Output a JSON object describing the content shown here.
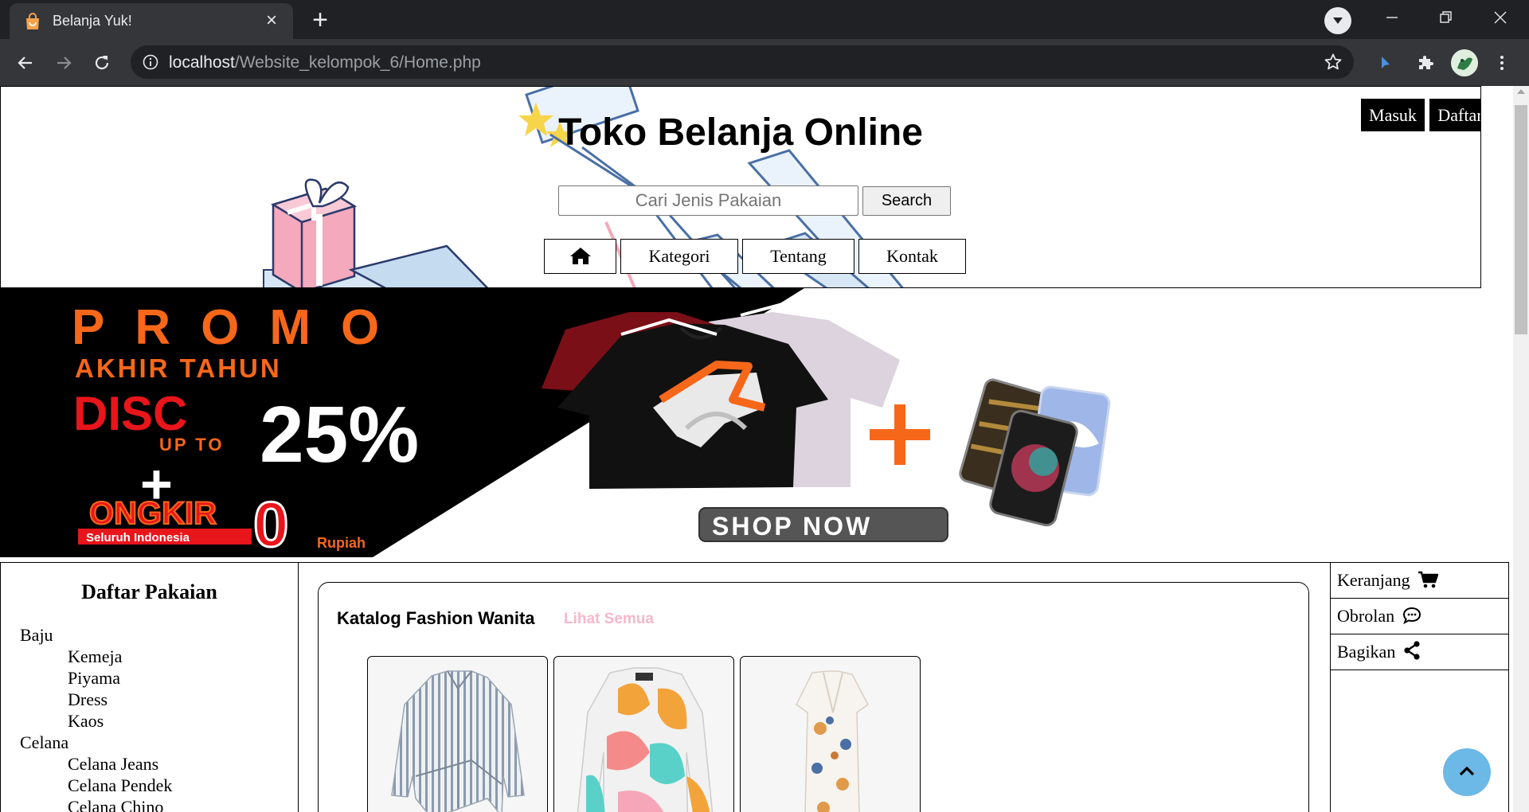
{
  "browser": {
    "tab_title": "Belanja Yuk!",
    "url_host": "localhost",
    "url_path": "/Website_kelompok_6/Home.php"
  },
  "header": {
    "title": "Toko Belanja Online",
    "search_placeholder": "Cari Jenis Pakaian",
    "search_button": "Search",
    "menu": {
      "kategori": "Kategori",
      "tentang": "Tentang",
      "kontak": "Kontak"
    },
    "login_button": "Masuk",
    "register_button": "Daftar"
  },
  "banner": {
    "promo": "PROMO",
    "promo_sub": "AKHIR TAHUN",
    "disc": "DISC",
    "up_to": "UP TO",
    "percent": "25%",
    "plus": "+",
    "ongkir": "ONGKIR",
    "ongkir_sub": "Seluruh Indonesia",
    "zero": "0",
    "rupiah": "Rupiah",
    "shop_now": "SHOP NOW"
  },
  "sidebar": {
    "title": "Daftar Pakaian",
    "baju": "Baju",
    "baju_items": [
      "Kemeja",
      "Piyama",
      "Dress",
      "Kaos"
    ],
    "celana": "Celana",
    "celana_items": [
      "Celana Jeans",
      "Celana Pendek",
      "Celana Chino"
    ]
  },
  "catalog": {
    "title": "Katalog Fashion Wanita",
    "see_all": "Lihat Semua"
  },
  "side_actions": {
    "cart": "Keranjang",
    "chat": "Obrolan",
    "share": "Bagikan"
  },
  "colors": {
    "promo_orange": "#f7671a",
    "disc_red": "#e8151b",
    "link_pink": "#f7b8c8",
    "scroll_top_blue": "#6cb8e6"
  }
}
